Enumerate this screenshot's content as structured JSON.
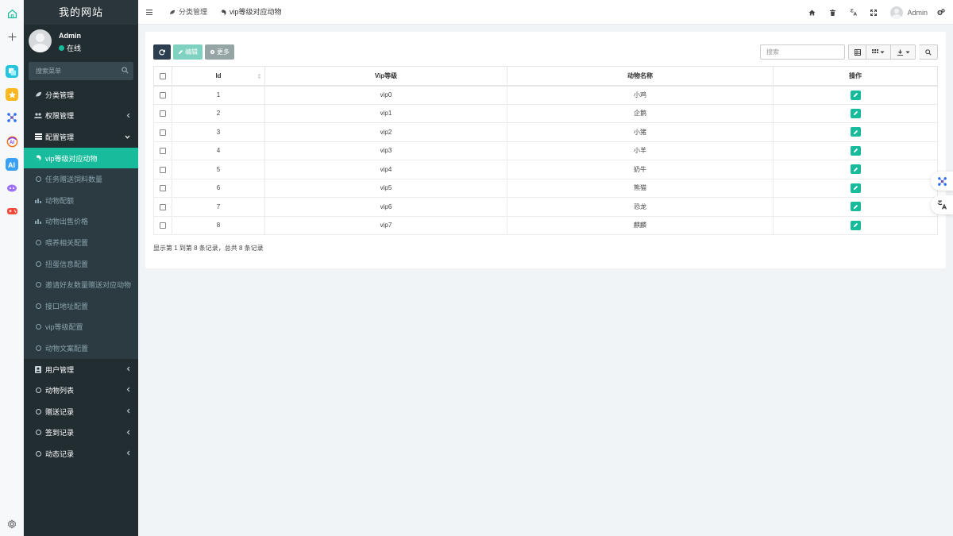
{
  "rail": {
    "items": [
      "home-icon",
      "plus-icon",
      "app-translate-icon",
      "app-star-icon",
      "app-network-icon",
      "app-ai-ring-icon",
      "app-ai-icon",
      "app-purple-icon",
      "app-game-icon",
      "settings-icon"
    ]
  },
  "sidebar": {
    "logo": "我的网站",
    "user_name": "Admin",
    "user_status": "在线",
    "search_placeholder": "搜索菜单",
    "items": [
      {
        "label": "分类管理",
        "type": "top"
      },
      {
        "label": "权限管理",
        "type": "top"
      },
      {
        "label": "配置管理",
        "type": "top"
      },
      {
        "label": "vip等级对应动物",
        "type": "active"
      },
      {
        "label": "任务赠送饲料数量",
        "type": "sub"
      },
      {
        "label": "动物配额",
        "type": "sub"
      },
      {
        "label": "动物出售价格",
        "type": "sub"
      },
      {
        "label": "喂养相关配置",
        "type": "sub"
      },
      {
        "label": "扭蛋信息配置",
        "type": "sub"
      },
      {
        "label": "邀请好友数量赠送对应动物",
        "type": "sub"
      },
      {
        "label": "接口地址配置",
        "type": "sub"
      },
      {
        "label": "vip等级配置",
        "type": "sub"
      },
      {
        "label": "动物文案配置",
        "type": "sub"
      },
      {
        "label": "用户管理",
        "type": "top"
      },
      {
        "label": "动物列表",
        "type": "top"
      },
      {
        "label": "赠送记录",
        "type": "top"
      },
      {
        "label": "签到记录",
        "type": "top"
      },
      {
        "label": "动态记录",
        "type": "top"
      }
    ]
  },
  "topbar": {
    "tabs": [
      "分类管理",
      "vip等级对应动物"
    ],
    "user_name": "Admin"
  },
  "toolbar": {
    "edit_label": "编辑",
    "more_label": "更多",
    "search_placeholder": "搜索"
  },
  "table": {
    "headers": [
      "Id",
      "Vip等级",
      "动物名称",
      "操作"
    ],
    "rows": [
      {
        "id": "1",
        "vip": "vip0",
        "animal": "小鸡"
      },
      {
        "id": "2",
        "vip": "vip1",
        "animal": "企鹅"
      },
      {
        "id": "3",
        "vip": "vip2",
        "animal": "小猪"
      },
      {
        "id": "4",
        "vip": "vip3",
        "animal": "小羊"
      },
      {
        "id": "5",
        "vip": "vip4",
        "animal": "奶牛"
      },
      {
        "id": "6",
        "vip": "vip5",
        "animal": "熊猫"
      },
      {
        "id": "7",
        "vip": "vip6",
        "animal": "恐龙"
      },
      {
        "id": "8",
        "vip": "vip7",
        "animal": "麒麟"
      }
    ]
  },
  "footer": {
    "info": "显示第 1 到第 8 条记录，总共 8 条记录"
  },
  "colors": {
    "accent": "#18bc9c",
    "sidebar_bg": "#222d32",
    "primary_dark": "#2c3e50"
  }
}
